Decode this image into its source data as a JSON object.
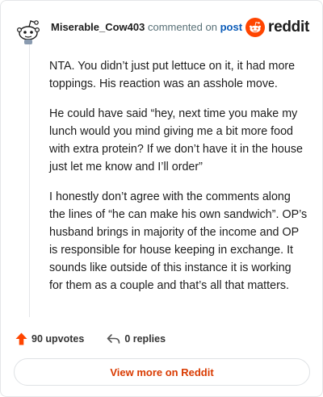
{
  "comment": {
    "username": "Miserable_Cow403",
    "action_text": "commented on",
    "post_link": "post",
    "brand": "reddit",
    "paragraphs": [
      "NTA. You didn’t just put lettuce on it, it had more toppings. His reaction was an asshole move.",
      "He could have said “hey, next time you make my lunch would you mind giving me a bit more food with extra protein? If we don’t have it in the house just let me know and I’ll order”",
      "I honestly don’t agree with the comments along the lines of “he can make his own sandwich”. OP’s husband brings in majority of the income and OP is responsible for house keeping in exchange. It sounds like outside of this instance it is working for them as a couple and that’s all that matters."
    ]
  },
  "footer": {
    "upvotes": "90 upvotes",
    "replies": "0 replies",
    "upvote_icon": "upvote-arrow-icon",
    "reply_icon": "reply-arrow-icon"
  },
  "view_more": "View more on Reddit",
  "colors": {
    "brand_orange": "#ff4500",
    "link_blue": "#0a5bb8",
    "view_more_text": "#d93a00"
  }
}
